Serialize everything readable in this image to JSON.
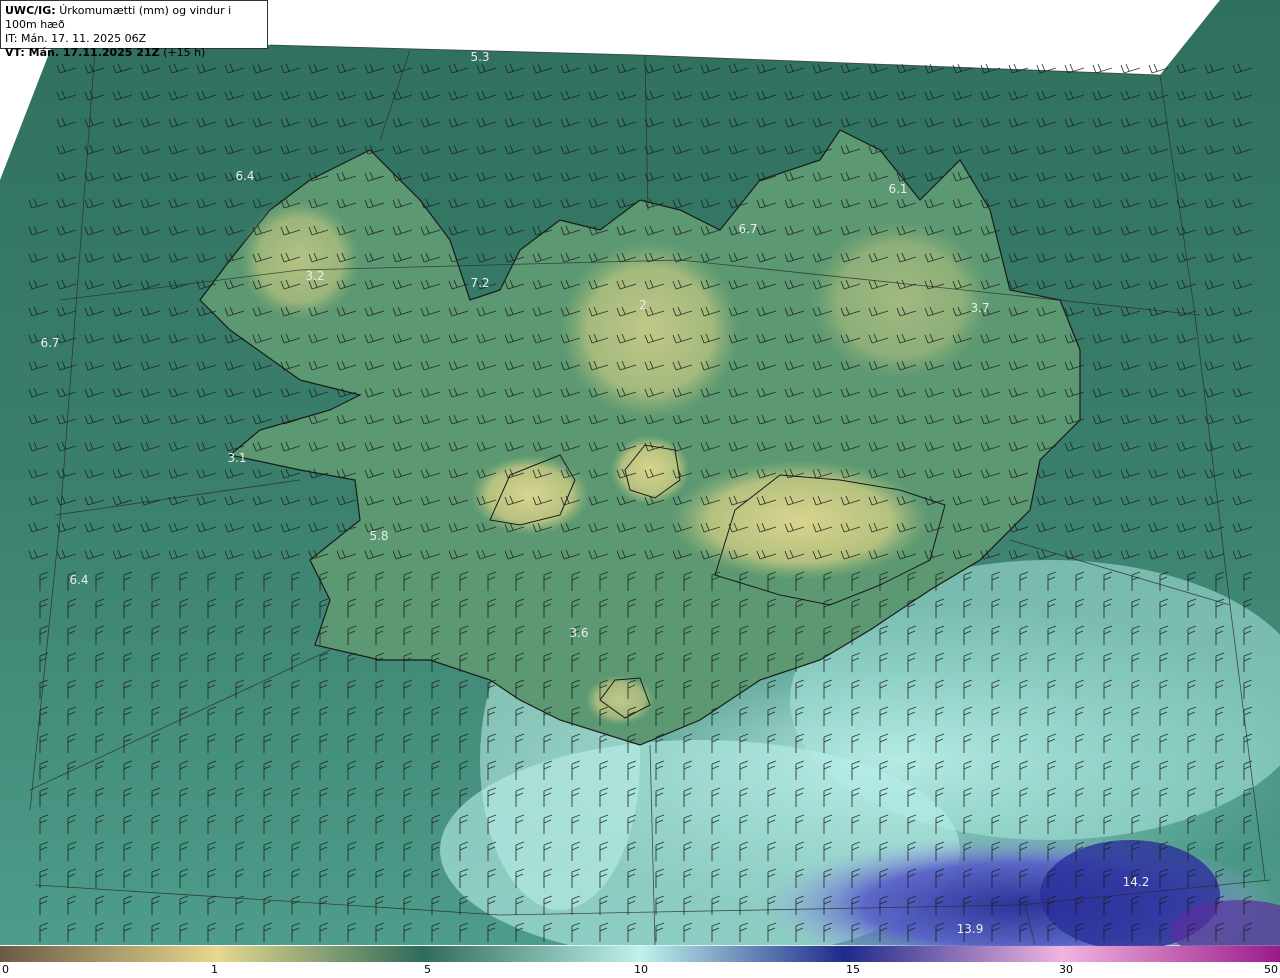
{
  "header": {
    "model": "UWC/IG:",
    "title": "Úrkomumætti (mm) og vindur i 100m hæð",
    "init_time": "IT: Mán. 17. 11. 2025 06Z",
    "valid_label": "VT: Mán. 17.11.2025 21Z",
    "lead_time": "(+15 h)"
  },
  "colors": {
    "low": "#7a6a50",
    "mid_yellow": "#d8d08a",
    "land_green": "#5f9a6e",
    "sea_teal": "#3f7f6a",
    "light_cyan": "#b9eee8",
    "blue": "#3a3fa8",
    "magenta": "#c23aa8"
  },
  "color_scale": {
    "ticks": [
      "0",
      "1",
      "5",
      "10",
      "15",
      "30",
      "50"
    ]
  },
  "precip_labels": [
    {
      "text": "5.3"
    },
    {
      "text": "6.4"
    },
    {
      "text": "3.2"
    },
    {
      "text": "7.2"
    },
    {
      "text": "6.7"
    },
    {
      "text": "2"
    },
    {
      "text": "6.7"
    },
    {
      "text": "6.1"
    },
    {
      "text": "3.7"
    },
    {
      "text": "3.1"
    },
    {
      "text": "5.8"
    },
    {
      "text": "6.4"
    },
    {
      "text": "3.6"
    },
    {
      "text": "14.2"
    },
    {
      "text": "13.9"
    }
  ]
}
